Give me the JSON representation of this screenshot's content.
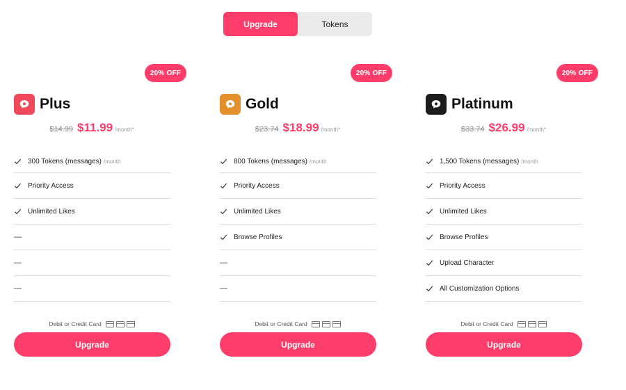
{
  "tabs": {
    "upgrade": "Upgrade",
    "tokens": "Tokens",
    "active": "Upgrade"
  },
  "colors": {
    "accent": "#fe3d6a",
    "plus_logo": "#f0485a",
    "gold_logo": "#e28f2c",
    "platinum_logo": "#1c1c1c"
  },
  "plans": [
    {
      "badge": "20% OFF",
      "name": "Plus",
      "old_price": "$14.99",
      "price": "$11.99",
      "per": "/month*",
      "icon": "chat-bubble-icon",
      "features": [
        {
          "text": "300 Tokens (messages)",
          "sub": "/month"
        },
        {
          "text": "Priority Access"
        },
        {
          "text": "Unlimited Likes"
        },
        {
          "text": "—"
        },
        {
          "text": "—"
        },
        {
          "text": "—"
        }
      ],
      "payment": "Debit or Credit Card",
      "button": "Upgrade"
    },
    {
      "badge": "20% OFF",
      "name": "Gold",
      "old_price": "$23.74",
      "price": "$18.99",
      "per": "/month*",
      "icon": "chat-bubble-icon",
      "features": [
        {
          "text": "800 Tokens (messages)",
          "sub": "/month"
        },
        {
          "text": "Priority Access"
        },
        {
          "text": "Unlimited Likes"
        },
        {
          "text": "Browse Profiles"
        },
        {
          "text": "—"
        },
        {
          "text": "—"
        }
      ],
      "payment": "Debit or Credit Card",
      "button": "Upgrade"
    },
    {
      "badge": "20% OFF",
      "name": "Platinum",
      "old_price": "$33.74",
      "price": "$26.99",
      "per": "/month*",
      "icon": "chat-bubble-icon",
      "features": [
        {
          "text": "1,500 Tokens (messages)",
          "sub": "/month"
        },
        {
          "text": "Priority Access"
        },
        {
          "text": "Unlimited Likes"
        },
        {
          "text": "Browse Profiles"
        },
        {
          "text": "Upload Character"
        },
        {
          "text": "All Customization Options"
        }
      ],
      "payment": "Debit or Credit Card",
      "button": "Upgrade"
    }
  ]
}
